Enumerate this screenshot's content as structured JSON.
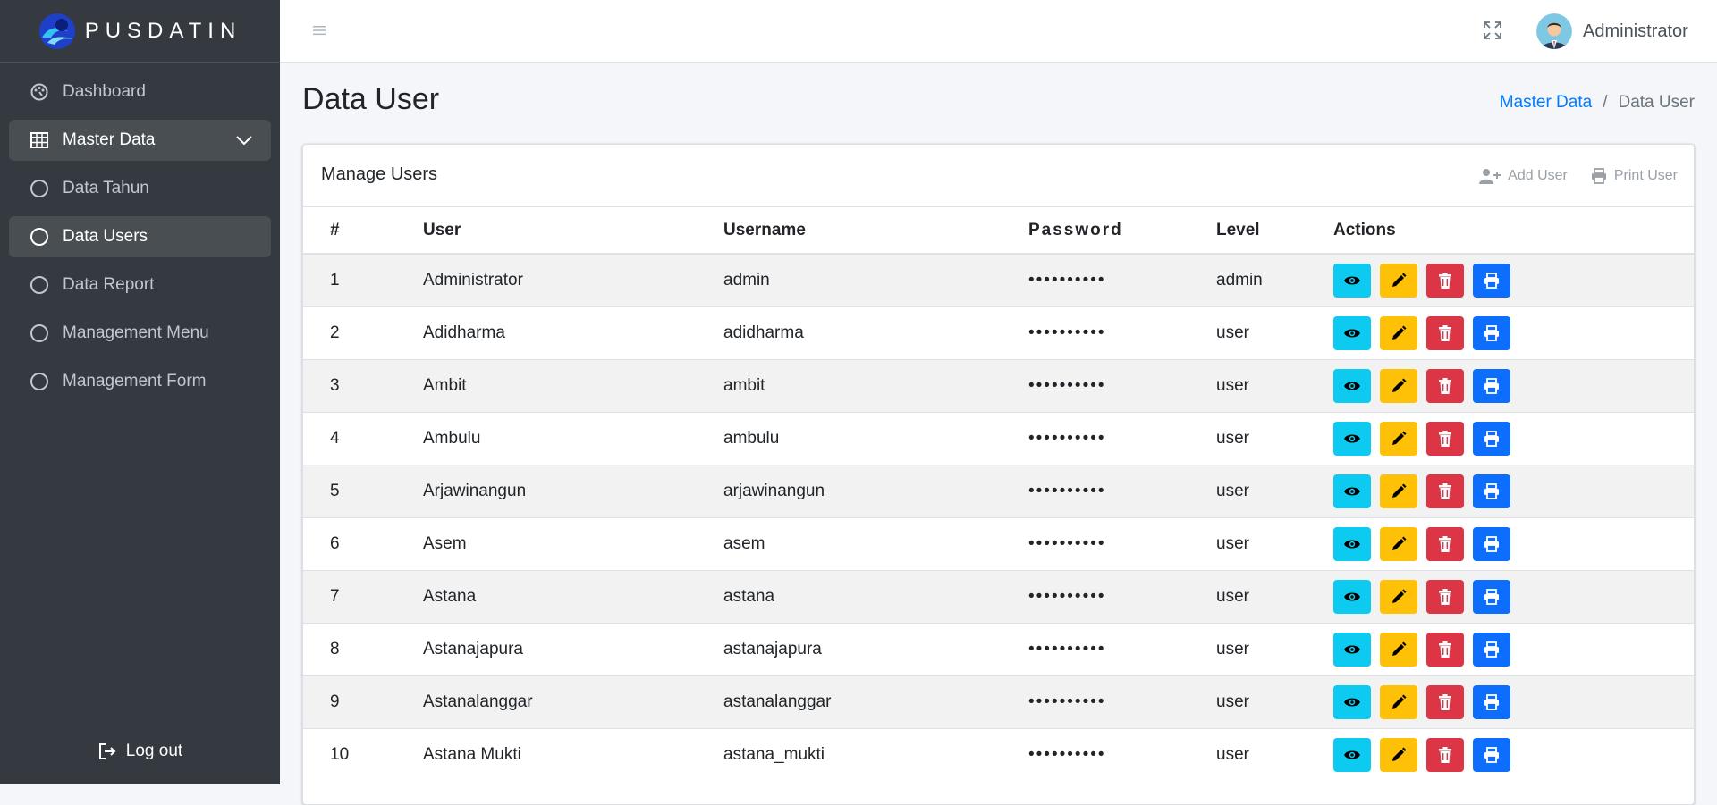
{
  "brand": {
    "name": "PUSDATIN"
  },
  "sidebar": {
    "items": [
      {
        "label": "Dashboard",
        "icon": "palette-icon"
      },
      {
        "label": "Master Data",
        "icon": "table-icon"
      },
      {
        "label": "Data Tahun",
        "icon": "circle-icon"
      },
      {
        "label": "Data Users",
        "icon": "circle-icon"
      },
      {
        "label": "Data Report",
        "icon": "circle-icon"
      },
      {
        "label": "Management Menu",
        "icon": "circle-icon"
      },
      {
        "label": "Management Form",
        "icon": "circle-icon"
      }
    ],
    "logout_label": "Log out"
  },
  "topbar": {
    "user_name": "Administrator"
  },
  "page": {
    "title": "Data User",
    "breadcrumb": {
      "parent": "Master Data",
      "separator": "/",
      "current": "Data User"
    }
  },
  "card": {
    "title": "Manage Users",
    "add_label": "Add User",
    "print_label": "Print User"
  },
  "table": {
    "headers": [
      "#",
      "User",
      "Username",
      "Password",
      "Level",
      "Actions"
    ],
    "rows": [
      {
        "num": "1",
        "user": "Administrator",
        "username": "admin",
        "password": "••••••••••",
        "level": "admin"
      },
      {
        "num": "2",
        "user": "Adidharma",
        "username": "adidharma",
        "password": "••••••••••",
        "level": "user"
      },
      {
        "num": "3",
        "user": "Ambit",
        "username": "ambit",
        "password": "••••••••••",
        "level": "user"
      },
      {
        "num": "4",
        "user": "Ambulu",
        "username": "ambulu",
        "password": "••••••••••",
        "level": "user"
      },
      {
        "num": "5",
        "user": "Arjawinangun",
        "username": "arjawinangun",
        "password": "••••••••••",
        "level": "user"
      },
      {
        "num": "6",
        "user": "Asem",
        "username": "asem",
        "password": "••••••••••",
        "level": "user"
      },
      {
        "num": "7",
        "user": "Astana",
        "username": "astana",
        "password": "••••••••••",
        "level": "user"
      },
      {
        "num": "8",
        "user": "Astanajapura",
        "username": "astanajapura",
        "password": "••••••••••",
        "level": "user"
      },
      {
        "num": "9",
        "user": "Astanalanggar",
        "username": "astanalanggar",
        "password": "••••••••••",
        "level": "user"
      },
      {
        "num": "10",
        "user": "Astana Mukti",
        "username": "astana_mukti",
        "password": "••••••••••",
        "level": "user"
      }
    ]
  },
  "colors": {
    "sidebar_bg": "#343a40",
    "view": "#0dcaf0",
    "edit": "#ffc107",
    "delete": "#dc3545",
    "print": "#0d6efd",
    "link": "#007bff"
  }
}
